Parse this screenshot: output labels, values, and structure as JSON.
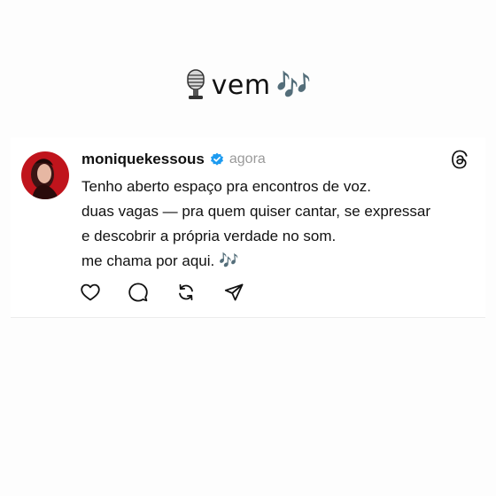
{
  "headline": {
    "word": "vem",
    "notes": "🎶"
  },
  "post": {
    "username": "moniquekessous",
    "time": "agora",
    "lines": [
      "Tenho aberto espaço pra encontros de voz.",
      "duas vagas — pra quem quiser cantar, se expressar",
      "e descobrir a própria verdade no som.",
      "me chama por aqui."
    ],
    "last_line_emoji": "🎶"
  },
  "icons": {
    "headline_left": "microphone-icon",
    "verified": "verified-badge-icon",
    "platform": "threads-logo-icon",
    "actions": [
      "heart-icon",
      "comment-icon",
      "repost-icon",
      "share-icon"
    ]
  },
  "colors": {
    "verified": "#1d9bf0",
    "muted_text": "#9a9a9a",
    "avatar_bg": "#c0141c"
  }
}
